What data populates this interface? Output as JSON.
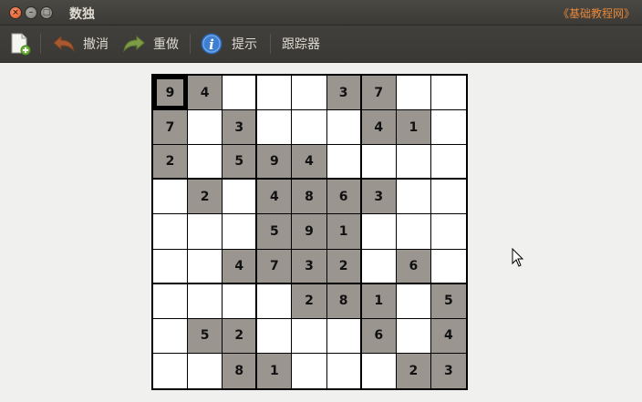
{
  "window": {
    "title": "数独",
    "brand": "《基础教程网》",
    "controls": [
      "close",
      "minimize",
      "maximize"
    ]
  },
  "toolbar": {
    "items": [
      {
        "icon": "new-game-icon",
        "label": ""
      },
      {
        "icon": "undo-icon",
        "label": "撤消"
      },
      {
        "icon": "redo-icon",
        "label": "重做"
      },
      {
        "icon": "info-icon",
        "label": "提示"
      },
      {
        "icon": "",
        "label": "跟踪器"
      }
    ]
  },
  "board": {
    "selected": [
      0,
      0
    ],
    "colors": {
      "given": "#9b9590",
      "empty": "#ffffff"
    },
    "grid": [
      [
        "9",
        "4",
        "",
        "",
        "",
        "3",
        "7",
        "",
        ""
      ],
      [
        "7",
        "",
        "3",
        "",
        "",
        "",
        "4",
        "1",
        ""
      ],
      [
        "2",
        "",
        "5",
        "9",
        "4",
        "",
        "",
        "",
        ""
      ],
      [
        "",
        "2",
        "",
        "4",
        "8",
        "6",
        "3",
        "",
        ""
      ],
      [
        "",
        "",
        "",
        "5",
        "9",
        "1",
        "",
        "",
        ""
      ],
      [
        "",
        "",
        "4",
        "7",
        "3",
        "2",
        "",
        "6",
        ""
      ],
      [
        "",
        "",
        "",
        "",
        "2",
        "8",
        "1",
        "",
        "5"
      ],
      [
        "",
        "5",
        "2",
        "",
        "",
        "",
        "6",
        "",
        "4"
      ],
      [
        "",
        "",
        "8",
        "1",
        "",
        "",
        "",
        "2",
        "3"
      ]
    ]
  }
}
